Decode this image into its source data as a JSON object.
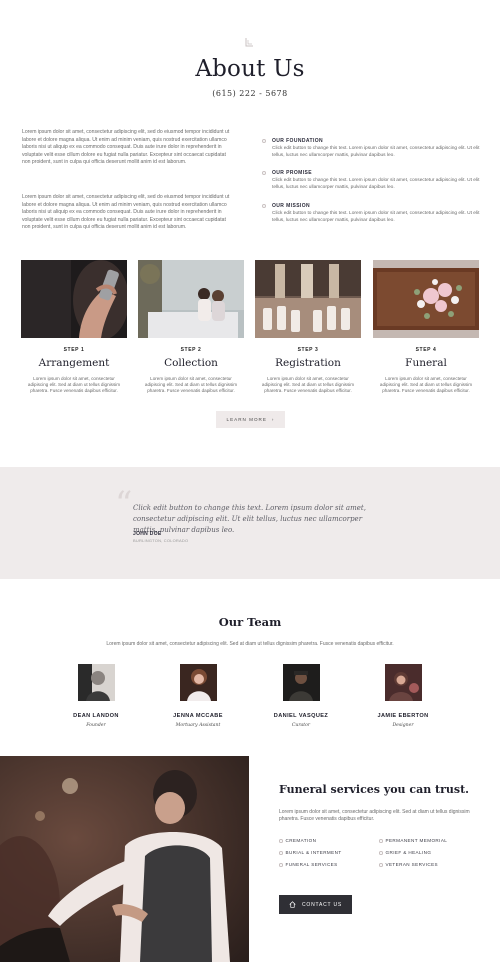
{
  "header": {
    "title": "About Us",
    "phone": "(615) 222 - 5678"
  },
  "intro": {
    "paragraphs": [
      "Lorem ipsum dolor sit amet, consectetur adipiscing elit, sed do eiusmod tempor incididunt ut labore et dolore magna aliqua. Ut enim ad minim veniam, quis nostrud exercitation ullamco laboris nisi ut aliquip ex ea commodo consequat. Duis aute irure dolor in reprehenderit in voluptate velit esse cillum dolore eu fugiat nulla pariatur. Excepteur sint occaecat cupidatat non proident, sunt in culpa qui officia deserunt mollit anim id est laborum.",
      "Lorem ipsum dolor sit amet, consectetur adipiscing elit, sed do eiusmod tempor incididunt ut labore et dolore magna aliqua. Ut enim ad minim veniam, quis nostrud exercitation ullamco laboris nisi ut aliquip ex ea commodo consequat. Duis aute irure dolor in reprehenderit in voluptate velit esse cillum dolore eu fugiat nulla pariatur. Excepteur sint occaecat cupidatat non proident, sunt in culpa qui officia deserunt mollit anim id est laborum."
    ]
  },
  "features": [
    {
      "title": "OUR FOUNDATION",
      "text": "Click edit button to change this text. Lorem ipsum dolor sit amet, consectetur adipiscing elit. Ut elit tellus, luctus nec ullamcorper mattis, pulvinar dapibus leo."
    },
    {
      "title": "OUR PROMISE",
      "text": "Click edit button to change this text. Lorem ipsum dolor sit amet, consectetur adipiscing elit. Ut elit tellus, luctus nec ullamcorper mattis, pulvinar dapibus leo."
    },
    {
      "title": "OUR MISSION",
      "text": "Click edit button to change this text. Lorem ipsum dolor sit amet, consectetur adipiscing elit. Ut elit tellus, luctus nec ullamcorper mattis, pulvinar dapibus leo."
    }
  ],
  "steps": [
    {
      "label": "STEP 1",
      "name": "Arrangement",
      "text": "Lorem ipsum dolor sit amet, consectetur adipiscing elit. Sed at diam ut tellus dignissim pharetra. Fusce venenatis dapibus efficitur."
    },
    {
      "label": "STEP 2",
      "name": "Collection",
      "text": "Lorem ipsum dolor sit amet, consectetur adipiscing elit. Sed at diam ut tellus dignissim pharetra. Fusce venenatis dapibus efficitur."
    },
    {
      "label": "STEP 3",
      "name": "Registration",
      "text": "Lorem ipsum dolor sit amet, consectetur adipiscing elit. Sed at diam ut tellus dignissim pharetra. Fusce venenatis dapibus efficitur."
    },
    {
      "label": "STEP 4",
      "name": "Funeral",
      "text": "Lorem ipsum dolor sit amet, consectetur adipiscing elit. Sed at diam ut tellus dignissim pharetra. Fusce venenatis dapibus efficitur."
    }
  ],
  "learn_more": "LEARN MORE",
  "testimonial": {
    "quote": "Click edit button to change this text. Lorem ipsum dolor sit amet, consectetur adipiscing elit. Ut elit tellus, luctus nec ullamcorper mattis, pulvinar dapibus leo.",
    "name": "JOHN DOE",
    "location": "BURLINGTON, COLORADO"
  },
  "team": {
    "title": "Our Team",
    "description": "Lorem ipsum dolor sit amet, consectetur adipiscing elit. Sed at diam ut tellus dignissim pharetra. Fusce venenatis dapibus efficitur.",
    "members": [
      {
        "name": "DEAN LANDON",
        "role": "Founder"
      },
      {
        "name": "JENNA MCCABE",
        "role": "Mortuary Assistant"
      },
      {
        "name": "DANIEL VASQUEZ",
        "role": "Curator"
      },
      {
        "name": "JAMIE EBERTON",
        "role": "Designer"
      }
    ]
  },
  "services": {
    "title": "Funeral services you can trust.",
    "description": "Lorem ipsum dolor sit amet, consectetur adipiscing elit. Sed at diam ut tellus dignissim pharetra. Fusce venenatis dapibus efficitur.",
    "items": [
      "CREMATION",
      "PERMANENT MEMORIAL",
      "BURIAL & INTERMENT",
      "GRIEF & HEALING",
      "FUNERAL SERVICES",
      "VETERAN SERVICES"
    ],
    "contact_label": "CONTACT US"
  },
  "icons": {
    "logo": "lily-logo-icon",
    "arrow": "arrow-right-icon",
    "home": "home-icon"
  }
}
